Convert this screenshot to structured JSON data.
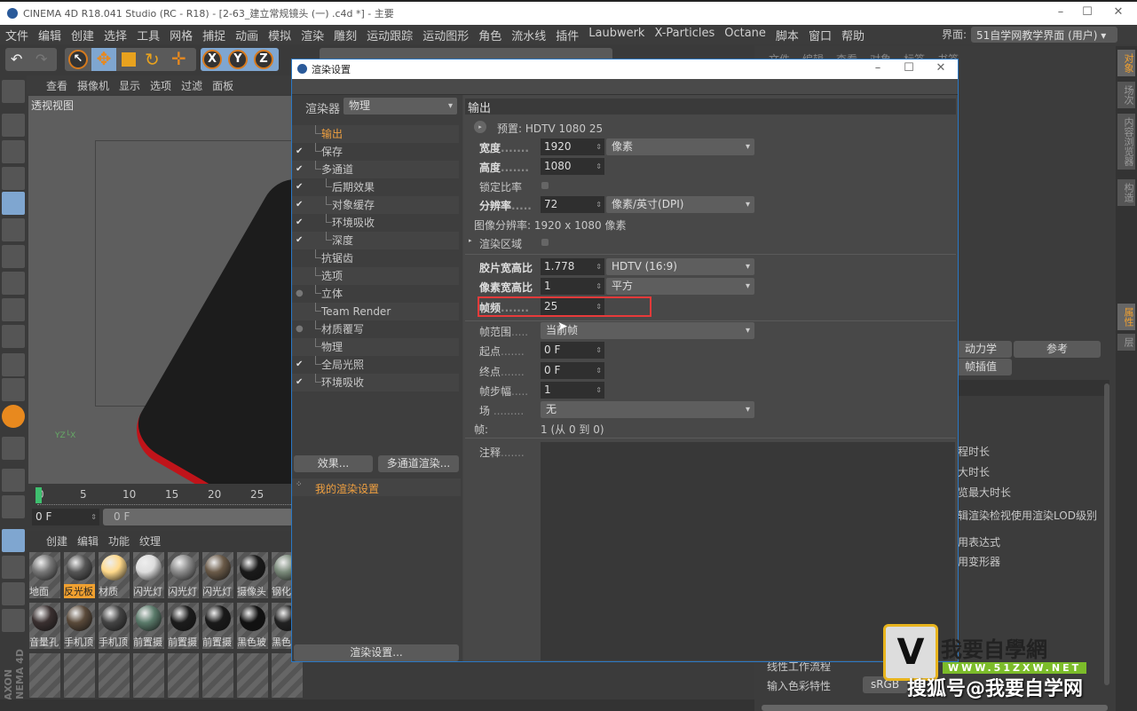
{
  "app": {
    "title": "CINEMA 4D R18.041 Studio (RC - R18) - [2-63_建立常规镜头 (一) .c4d *] - 主要"
  },
  "menu": [
    "文件",
    "编辑",
    "创建",
    "选择",
    "工具",
    "网格",
    "捕捉",
    "动画",
    "模拟",
    "渲染",
    "雕刻",
    "运动跟踪",
    "运动图形",
    "角色",
    "流水线",
    "插件",
    "Laubwerk",
    "X-Particles",
    "Octane",
    "脚本",
    "窗口",
    "帮助"
  ],
  "layout": {
    "label": "界面:",
    "value": "51自学网教学界面 (用户)"
  },
  "toolbar": {
    "axes": [
      "X",
      "Y",
      "Z"
    ]
  },
  "viewport": {
    "menu": [
      "查看",
      "摄像机",
      "显示",
      "选项",
      "过滤",
      "面板"
    ],
    "label": "透视视图"
  },
  "timeline": {
    "ticks": [
      "0",
      "5",
      "10",
      "15",
      "20",
      "25"
    ],
    "current": "0 F",
    "start": "0 F"
  },
  "materials": {
    "menu": [
      "创建",
      "编辑",
      "功能",
      "纹理"
    ],
    "items": [
      {
        "label": "地面",
        "color": "#777"
      },
      {
        "label": "反光板",
        "color": "#555",
        "selected": true
      },
      {
        "label": "材质",
        "color": "#ffd98a"
      },
      {
        "label": "闪光灯",
        "color": "#ddd"
      },
      {
        "label": "闪光灯",
        "color": "#8a8a8a"
      },
      {
        "label": "闪光灯",
        "color": "#6a5a48"
      },
      {
        "label": "摄像头",
        "color": "#1a1a1a"
      },
      {
        "label": "钢化",
        "color": "#7a8a7a"
      },
      {
        "label": "音量孔",
        "color": "#3a3030"
      },
      {
        "label": "手机顶",
        "color": "#5a4a3a"
      },
      {
        "label": "手机顶",
        "color": "#444"
      },
      {
        "label": "前置摄",
        "color": "#5a7a6a"
      },
      {
        "label": "前置摄",
        "color": "#1c1c1c"
      },
      {
        "label": "前置摄",
        "color": "#1a1a1a"
      },
      {
        "label": "黑色玻",
        "color": "#111"
      },
      {
        "label": "黑色",
        "color": "#222"
      }
    ]
  },
  "object_panel": {
    "menu": [
      "文件",
      "编辑",
      "查看",
      "对象",
      "标签",
      "书签"
    ]
  },
  "attr_panel": {
    "tabs": [
      "动力学",
      "参考",
      "帧插值"
    ],
    "rows": [
      "程时长",
      "大时长",
      "览最大时长",
      "辑渲染检视使用渲染LOD级别",
      "用表达式",
      "用变形器",
      "线性工作流程",
      "输入色彩特性"
    ],
    "color_profile": "sRGB"
  },
  "side_tabs": [
    "对象",
    "场次",
    "内容浏览器",
    "构造",
    "属性",
    "层"
  ],
  "dialog": {
    "title": "渲染设置",
    "renderer_label": "渲染器",
    "renderer": "物理",
    "tree": [
      {
        "label": "输出",
        "check": "",
        "active": true,
        "indent": 0
      },
      {
        "label": "保存",
        "check": "✔",
        "indent": 0
      },
      {
        "label": "多通道",
        "check": "✔",
        "indent": 0
      },
      {
        "label": "后期效果",
        "check": "✔",
        "indent": 1
      },
      {
        "label": "对象缓存",
        "check": "✔",
        "indent": 1
      },
      {
        "label": "环境吸收",
        "check": "✔",
        "indent": 1
      },
      {
        "label": "深度",
        "check": "✔",
        "indent": 1
      },
      {
        "label": "抗锯齿",
        "check": "",
        "indent": 0
      },
      {
        "label": "选项",
        "check": "",
        "indent": 0
      },
      {
        "label": "立体",
        "check": "●",
        "indent": 0
      },
      {
        "label": "Team Render",
        "check": "",
        "indent": 0
      },
      {
        "label": "材质覆写",
        "check": "●",
        "indent": 0
      },
      {
        "label": "物理",
        "check": "",
        "indent": 0
      },
      {
        "label": "全局光照",
        "check": "✔",
        "indent": 0
      },
      {
        "label": "环境吸收",
        "check": "✔",
        "indent": 0
      }
    ],
    "effects_button": "效果...",
    "multipass_button": "多通道渲染...",
    "preset_item": "我的渲染设置",
    "render_settings_button": "渲染设置...",
    "section": "输出",
    "preset": "预置: HDTV 1080 25",
    "width_label": "宽度",
    "width": "1920",
    "width_unit": "像素",
    "height_label": "高度",
    "height": "1080",
    "lock_ratio": "锁定比率",
    "resolution_label": "分辨率",
    "resolution": "72",
    "resolution_unit": "像素/英寸(DPI)",
    "image_res": "图像分辨率: 1920 x 1080 像素",
    "render_region": "渲染区域",
    "film_aspect_label": "胶片宽高比",
    "film_aspect": "1.778",
    "film_aspect_preset": "HDTV (16:9)",
    "pixel_aspect_label": "像素宽高比",
    "pixel_aspect": "1",
    "pixel_aspect_preset": "平方",
    "fps_label": "帧频",
    "fps": "25",
    "frame_range_label": "帧范围",
    "frame_range": "当前帧",
    "start_label": "起点",
    "start": "0 F",
    "end_label": "终点",
    "end": "0 F",
    "step_label": "帧步幅",
    "step": "1",
    "field_label": "场",
    "field": "无",
    "frames_label": "帧:",
    "frames": "1 (从 0 到 0)",
    "notes_label": "注释",
    "highlight_color": "#e83a3a"
  },
  "watermark": {
    "site": "我要自學網",
    "url": "WWW.51ZXW.NET",
    "credit": "搜狐号@我要自学网"
  }
}
